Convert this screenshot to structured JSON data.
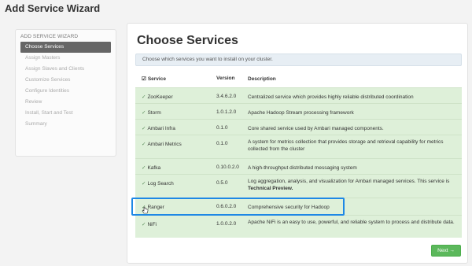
{
  "header": {
    "title": "Add Service Wizard"
  },
  "sidebar": {
    "heading": "ADD SERVICE WIZARD",
    "items": [
      {
        "label": "Choose Services",
        "active": true
      },
      {
        "label": "Assign Masters"
      },
      {
        "label": "Assign Slaves and Clients"
      },
      {
        "label": "Customize Services"
      },
      {
        "label": "Configure Identities"
      },
      {
        "label": "Review"
      },
      {
        "label": "Install, Start and Test"
      },
      {
        "label": "Summary"
      }
    ]
  },
  "main": {
    "title": "Choose Services",
    "info": "Choose which services you want to install on your cluster.",
    "columns": {
      "service": "Service",
      "version": "Version",
      "description": "Description"
    },
    "rows": [
      {
        "service": "ZooKeeper",
        "version": "3.4.6.2.0",
        "description": "Centralized service which provides highly reliable distributed coordination"
      },
      {
        "service": "Storm",
        "version": "1.0.1.2.0",
        "description": "Apache Hadoop Stream processing framework"
      },
      {
        "service": "Ambari Infra",
        "version": "0.1.0",
        "description": "Core shared service used by Ambari managed components."
      },
      {
        "service": "Ambari Metrics",
        "version": "0.1.0",
        "description": "A system for metrics collection that provides storage and retrieval capability for metrics collected from the cluster"
      },
      {
        "service": "Kafka",
        "version": "0.10.0.2.0",
        "description": "A high-throughput distributed messaging system"
      },
      {
        "service": "Log Search",
        "version": "0.5.0",
        "description": "Log aggregation, analysis, and visualization for Ambari managed services. This service is",
        "description_bold": "Technical Preview."
      },
      {
        "service": "Ranger",
        "version": "0.6.0.2.0",
        "description": "Comprehensive security for Hadoop"
      },
      {
        "service": "NiFi",
        "version": "1.0.0.2.0",
        "description": "Apache NiFi is an easy to use, powerful, and reliable system to process and distribute data."
      }
    ],
    "next_label": "Next →"
  },
  "colors": {
    "row_bg": "#def0d9",
    "highlight": "#1e88e5",
    "next": "#5cb85c"
  },
  "icons": {
    "checkbox": "checkbox-icon",
    "cursor": "hand-cursor-icon"
  }
}
